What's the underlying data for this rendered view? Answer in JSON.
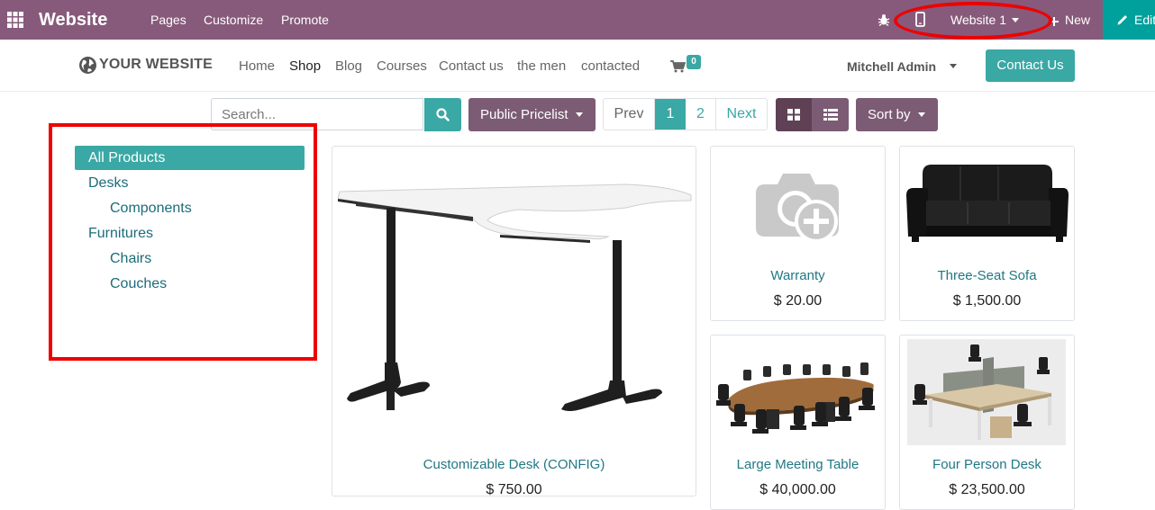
{
  "admin_bar": {
    "app_title": "Website",
    "menu": [
      "Pages",
      "Customize",
      "Promote"
    ],
    "website_selector": "Website 1",
    "new_label": "New",
    "edit_label": "Edit",
    "color": "#875a7b"
  },
  "site_nav": {
    "logo_text": "YOUR WEBSITE",
    "links": [
      "Home",
      "Shop",
      "Blog",
      "Courses",
      "Contact us",
      "the men",
      "contacted"
    ],
    "active_link": "Shop",
    "cart_count": "0",
    "user_name": "Mitchell Admin",
    "contact_button": "Contact Us"
  },
  "toolbar": {
    "search_placeholder": "Search...",
    "pricelist_label": "Public Pricelist",
    "pager": {
      "prev": "Prev",
      "pages": [
        "1",
        "2"
      ],
      "current": "1",
      "next": "Next"
    },
    "sort_label": "Sort by"
  },
  "categories": {
    "all": "All Products",
    "items": [
      {
        "label": "Desks",
        "children": [
          "Components"
        ]
      },
      {
        "label": "Furnitures",
        "children": [
          "Chairs",
          "Couches"
        ]
      }
    ]
  },
  "products": [
    {
      "name": "Customizable Desk (CONFIG)",
      "price": "$ 750.00"
    },
    {
      "name": "Warranty",
      "price": "$ 20.00"
    },
    {
      "name": "Three-Seat Sofa",
      "price": "$ 1,500.00"
    },
    {
      "name": "Large Meeting Table",
      "price": "$ 40,000.00"
    },
    {
      "name": "Four Person Desk",
      "price": "$ 23,500.00"
    }
  ],
  "colors": {
    "accent": "#3aa8a4",
    "purple_button": "#7c5b74",
    "highlight": "#ee0000"
  }
}
